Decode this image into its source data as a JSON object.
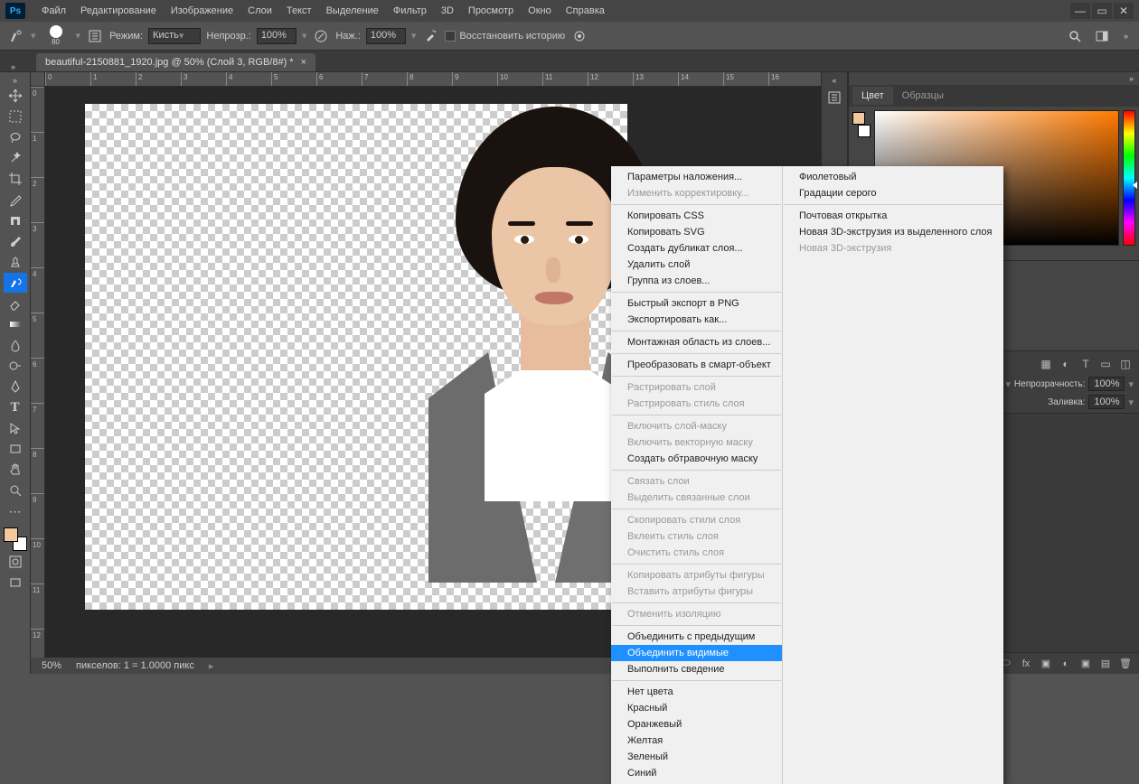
{
  "menubar": {
    "items": [
      "Файл",
      "Редактирование",
      "Изображение",
      "Слои",
      "Текст",
      "Выделение",
      "Фильтр",
      "3D",
      "Просмотр",
      "Окно",
      "Справка"
    ]
  },
  "optionsbar": {
    "brush_size": "80",
    "mode_label": "Режим:",
    "mode_value": "Кисть",
    "opacity_label": "Непрозр.:",
    "opacity_value": "100%",
    "flow_label": "Наж.:",
    "flow_value": "100%",
    "restore_history": "Восстановить историю"
  },
  "tab": {
    "title": "beautiful-2150881_1920.jpg @ 50% (Слой 3, RGB/8#) *"
  },
  "ruler_ticks": [
    "0",
    "1",
    "2",
    "3",
    "4",
    "5",
    "6",
    "7",
    "8",
    "9",
    "10",
    "11",
    "12",
    "13",
    "14",
    "15",
    "16"
  ],
  "ruler_vticks": [
    "0",
    "1",
    "2",
    "3",
    "4",
    "5",
    "6",
    "7",
    "8",
    "9",
    "10",
    "11",
    "12"
  ],
  "status": {
    "zoom": "50%",
    "info": "пикселов: 1 = 1.0000 пикс"
  },
  "panels": {
    "color_tab": "Цвет",
    "swatches_tab": "Образцы"
  },
  "layers": {
    "opacity_label": "Непрозрачность:",
    "opacity_value": "100%",
    "fill_label": "Заливка:",
    "fill_value": "100%"
  },
  "context_menu": {
    "col1": [
      {
        "t": "Параметры наложения...",
        "d": false
      },
      {
        "t": "Изменить корректировку...",
        "d": true
      },
      {
        "sep": true
      },
      {
        "t": "Копировать CSS",
        "d": false
      },
      {
        "t": "Копировать SVG",
        "d": false
      },
      {
        "t": "Создать дубликат слоя...",
        "d": false
      },
      {
        "t": "Удалить слой",
        "d": false
      },
      {
        "t": "Группа из слоев...",
        "d": false
      },
      {
        "sep": true
      },
      {
        "t": "Быстрый экспорт в PNG",
        "d": false
      },
      {
        "t": "Экспортировать как...",
        "d": false
      },
      {
        "sep": true
      },
      {
        "t": "Монтажная область из слоев...",
        "d": false
      },
      {
        "sep": true
      },
      {
        "t": "Преобразовать в смарт-объект",
        "d": false
      },
      {
        "sep": true
      },
      {
        "t": "Растрировать слой",
        "d": true
      },
      {
        "t": "Растрировать стиль слоя",
        "d": true
      },
      {
        "sep": true
      },
      {
        "t": "Включить слой-маску",
        "d": true
      },
      {
        "t": "Включить векторную маску",
        "d": true
      },
      {
        "t": "Создать обтравочную маску",
        "d": false
      },
      {
        "sep": true
      },
      {
        "t": "Связать слои",
        "d": true
      },
      {
        "t": "Выделить связанные слои",
        "d": true
      },
      {
        "sep": true
      },
      {
        "t": "Скопировать стили слоя",
        "d": true
      },
      {
        "t": "Вклеить стиль слоя",
        "d": true
      },
      {
        "t": "Очистить стиль слоя",
        "d": true
      },
      {
        "sep": true
      },
      {
        "t": "Копировать атрибуты фигуры",
        "d": true
      },
      {
        "t": "Вставить атрибуты фигуры",
        "d": true
      },
      {
        "sep": true
      },
      {
        "t": "Отменить изоляцию",
        "d": true
      },
      {
        "sep": true
      },
      {
        "t": "Объединить с предыдущим",
        "d": false
      },
      {
        "t": "Объединить видимые",
        "d": false,
        "hl": true
      },
      {
        "t": "Выполнить сведение",
        "d": false
      },
      {
        "sep": true
      },
      {
        "t": "Нет цвета",
        "d": false
      },
      {
        "t": "Красный",
        "d": false
      },
      {
        "t": "Оранжевый",
        "d": false
      },
      {
        "t": "Желтая",
        "d": false
      },
      {
        "t": "Зеленый",
        "d": false
      },
      {
        "t": "Синий",
        "d": false
      }
    ],
    "col2": [
      {
        "t": "Фиолетовый",
        "d": false
      },
      {
        "t": "Градации серого",
        "d": false
      },
      {
        "sep": true
      },
      {
        "t": "Почтовая открытка",
        "d": false
      },
      {
        "t": "Новая 3D-экструзия из выделенного слоя",
        "d": false
      },
      {
        "t": "Новая 3D-экструзия",
        "d": true
      }
    ]
  }
}
